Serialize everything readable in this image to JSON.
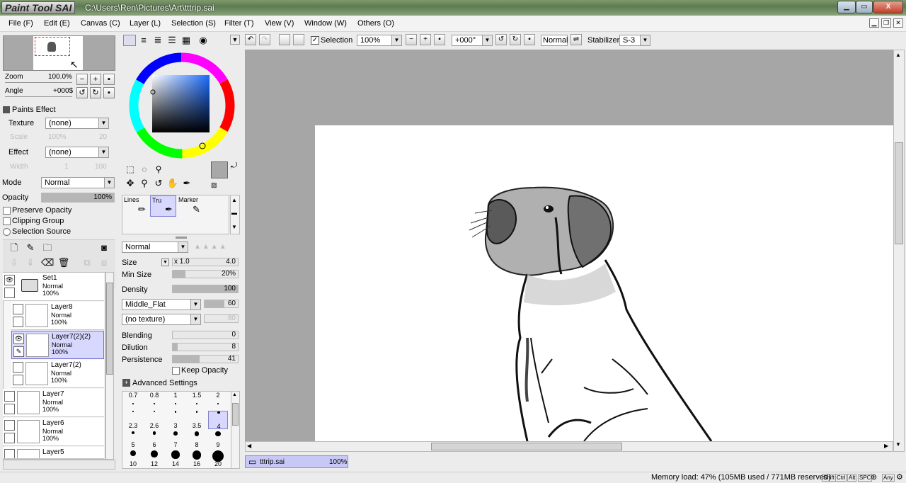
{
  "window": {
    "app_logo": "PaintTool SAI",
    "path": "C:\\Users\\Ren\\Pictures\\Art\\tttrip.sai",
    "min": "▁",
    "max": "▭",
    "close": "X"
  },
  "menu": [
    "File (F)",
    "Edit (E)",
    "Canvas (C)",
    "Layer (L)",
    "Selection (S)",
    "Filter (T)",
    "View (V)",
    "Window (W)",
    "Others (O)"
  ],
  "navigator": {
    "zoom_label": "Zoom",
    "zoom_value": "100.0%",
    "angle_label": "Angle",
    "angle_value": "+000$"
  },
  "paints_effect": {
    "title": "Paints Effect",
    "texture_label": "Texture",
    "texture_value": "(none)",
    "scale_label": "Scale",
    "scale_value": "100%",
    "scale_num": "20",
    "effect_label": "Effect",
    "effect_value": "(none)",
    "width_label": "Width",
    "width_value": "1",
    "width_num": "100"
  },
  "layer_props": {
    "mode_label": "Mode",
    "mode_value": "Normal",
    "opacity_label": "Opacity",
    "opacity_value": "100%",
    "preserve_opacity": "Preserve Opacity",
    "clipping_group": "Clipping Group",
    "selection_source": "Selection Source"
  },
  "layers": [
    {
      "name": "Set1",
      "mode": "Normal",
      "opacity": "100%",
      "folder": true
    },
    {
      "name": "Layer8",
      "mode": "Normal",
      "opacity": "100%"
    },
    {
      "name": "Layer7(2)(2)",
      "mode": "Normal",
      "opacity": "100%",
      "selected": true
    },
    {
      "name": "Layer7(2)",
      "mode": "Normal",
      "opacity": "100%"
    },
    {
      "name": "Layer7",
      "mode": "Normal",
      "opacity": "100%"
    },
    {
      "name": "Layer6",
      "mode": "Normal",
      "opacity": "100%"
    },
    {
      "name": "Layer5",
      "mode": "",
      "opacity": ""
    }
  ],
  "brush_tools": [
    {
      "name": "Lines"
    },
    {
      "name": "Tru",
      "selected": true
    },
    {
      "name": "Marker"
    }
  ],
  "brush": {
    "blend_mode": "Normal",
    "size_label": "Size",
    "size_mult": "x 1.0",
    "size_value": "4.0",
    "min_size_label": "Min Size",
    "min_size_value": "20%",
    "density_label": "Density",
    "density_value": "100",
    "shape": "Middle_Flat",
    "shape_value": "60",
    "texture": "(no texture)",
    "texture_value": "80",
    "blending_label": "Blending",
    "blending_value": "0",
    "dilution_label": "Dilution",
    "dilution_value": "8",
    "persistence_label": "Persistence",
    "persistence_value": "41",
    "keep_opacity": "Keep Opacity",
    "advanced": "Advanced Settings"
  },
  "brush_sizes": [
    [
      "0.7",
      "0.8",
      "1",
      "1.5",
      "2"
    ],
    [
      "2.3",
      "2.6",
      "3",
      "3.5",
      "4"
    ],
    [
      "5",
      "6",
      "7",
      "8",
      "9"
    ],
    [
      "10",
      "12",
      "14",
      "16",
      "20"
    ]
  ],
  "canvas_toolbar": {
    "selection_label": "Selection",
    "zoom": "100%",
    "angle": "+000°",
    "mode": "Normal",
    "stabilizer_label": "Stabilizer",
    "stabilizer_value": "S-3"
  },
  "doc_tab": {
    "name": "tttrip.sai",
    "zoom": "100%"
  },
  "status": {
    "memory": "Memory load: 47% (105MB used / 771MB reserved)",
    "keys": [
      "Shift",
      "Ctrl",
      "Alt",
      "SPC",
      "Any"
    ]
  },
  "colors": {
    "accent_selection": "#d8d8ff",
    "title_bar": "#6f8c61"
  }
}
